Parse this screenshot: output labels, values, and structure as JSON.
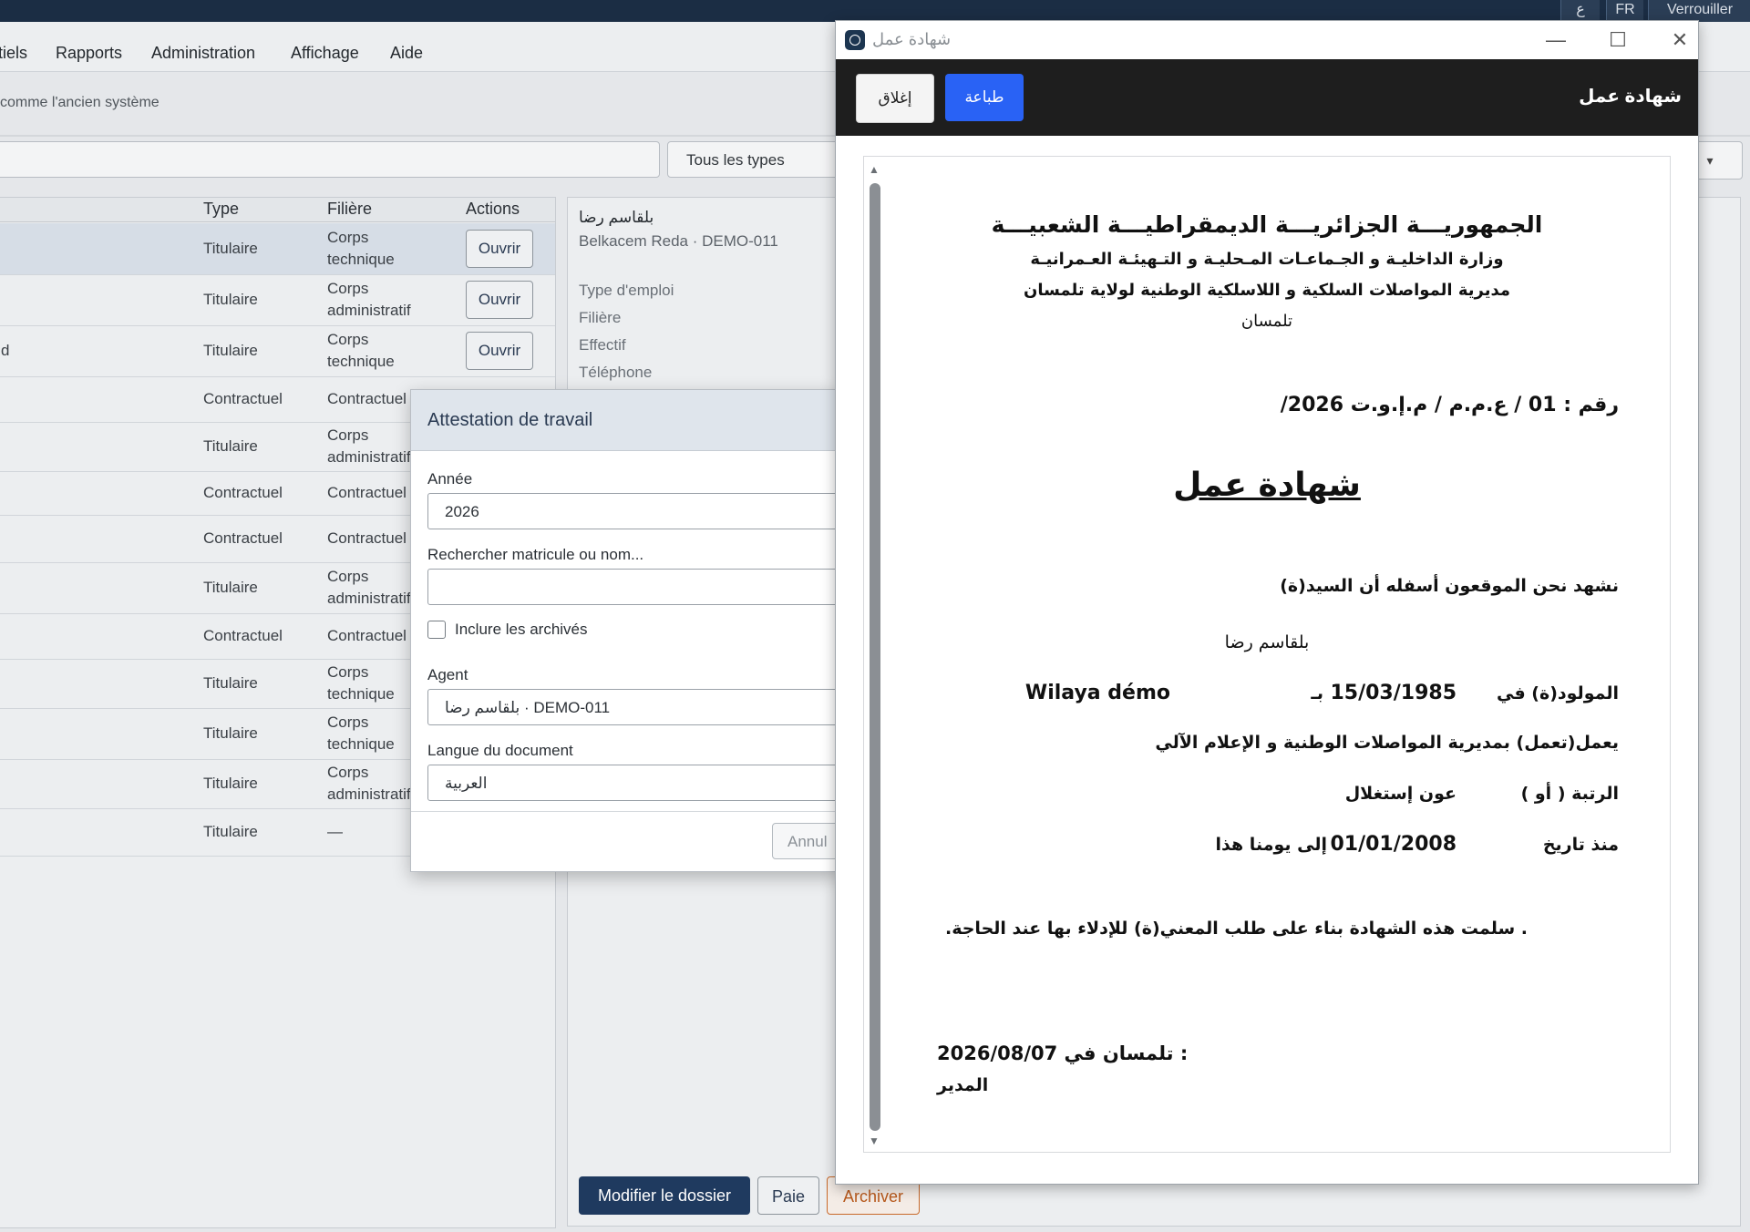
{
  "topbar": {
    "lang_ar": "ع",
    "lang_fr": "FR",
    "lock": "Verrouiller"
  },
  "menu": {
    "items": [
      "tiels",
      "Rapports",
      "Administration",
      "Affichage",
      "Aide"
    ]
  },
  "info_text": "comme l'ancien système",
  "filters": {
    "type_select": "Tous les types",
    "right_select": "▾"
  },
  "table": {
    "headers": {
      "type": "Type",
      "filiere": "Filière",
      "actions": "Actions"
    },
    "open_label": "Ouvrir",
    "rows": [
      {
        "name": "",
        "type": "Titulaire",
        "filiere": [
          "Corps",
          "technique"
        ],
        "open": true,
        "selected": true
      },
      {
        "name": "",
        "type": "Titulaire",
        "filiere": [
          "Corps",
          "administratif"
        ],
        "open": true
      },
      {
        "name": "d",
        "type": "Titulaire",
        "filiere": [
          "Corps",
          "technique"
        ],
        "open": true
      },
      {
        "name": "",
        "type": "Contractuel",
        "filiere": [
          "Contractuel"
        ],
        "open": false
      },
      {
        "name": "",
        "type": "Titulaire",
        "filiere": [
          "Corps",
          "administratif"
        ],
        "open": false
      },
      {
        "name": "",
        "type": "Contractuel",
        "filiere": [
          "Contractuel"
        ],
        "open": false
      },
      {
        "name": "",
        "type": "Contractuel",
        "filiere": [
          "Contractuel"
        ],
        "open": false
      },
      {
        "name": "",
        "type": "Titulaire",
        "filiere": [
          "Corps",
          "administratif"
        ],
        "open": false
      },
      {
        "name": "",
        "type": "Contractuel",
        "filiere": [
          "Contractuel"
        ],
        "open": false
      },
      {
        "name": "",
        "type": "Titulaire",
        "filiere": [
          "Corps",
          "technique"
        ],
        "open": false
      },
      {
        "name": "",
        "type": "Titulaire",
        "filiere": [
          "Corps",
          "technique"
        ],
        "open": false
      },
      {
        "name": "",
        "type": "Titulaire",
        "filiere": [
          "Corps",
          "administratif"
        ],
        "open": false
      },
      {
        "name": "",
        "type": "Titulaire",
        "filiere": [
          "—"
        ],
        "open": false
      }
    ]
  },
  "detail": {
    "name_ar": "بلقاسم رضا",
    "subtitle": "Belkacem Reda · DEMO-011",
    "labels": [
      "Type d'emploi",
      "Filière",
      "Effectif",
      "Téléphone"
    ],
    "buttons": {
      "edit": "Modifier le dossier",
      "pay": "Paie",
      "archive": "Archiver"
    }
  },
  "modal": {
    "title": "Attestation de travail",
    "year_label": "Année",
    "year_value": "2026",
    "search_label": "Rechercher matricule ou nom...",
    "search_value": "",
    "include_archived": "Inclure les archivés",
    "agent_label": "Agent",
    "agent_value": "بلقاسم رضا · DEMO-011",
    "lang_label": "Langue du document",
    "lang_value": "العربية",
    "cancel": "Annul"
  },
  "preview": {
    "window_title": "شهادة عمل",
    "toolbar_title": "شهادة عمل",
    "close": "إغلاق",
    "print": "طباعة",
    "doc": {
      "republic": "الجمهوريـــة الجزائريـــة الديمقراطيـــة الشعبيـــة",
      "ministry": "وزارة الداخليـة و الجـماعـات المـحليـة و التـهيئـة العـمرانيـة",
      "directorate": "مديرية المواصلات السلكية و اللاسلكية الوطنية لولاية تلمسان",
      "city": "تلمسان",
      "ref_prefix": "رقم :",
      "ref_number": "01",
      "ref_suffix": "/ ع.م.م / م.إ.و.ت 2026/",
      "heading": "شهادة عمل",
      "attest_line": "نشهد نحن الموقعون أسفله أن السيد(ة)",
      "agent_name": "بلقاسم رضا",
      "born_label": "المولود(ة) في",
      "birth_date": "15/03/1985",
      "at_label": "بـ",
      "birth_place": "Wilaya démo",
      "works_line": "يعمل(تعمل) بمديرية المواصلات الوطنية و الإعلام الآلي",
      "rank_label": "الرتبة ( أو )",
      "rank_value": "عون إستغلال",
      "since_label": "منذ تاريخ",
      "since_date": "01/01/2008",
      "until_today": "إلى يومنا هذا",
      "issued_line": ". سلمت هذه الشهادة بناء على طلب المعني(ة) للإدلاء بها عند الحاجة.",
      "place_date_label": "تلمسان في :",
      "place_date_value": "2026/08/07",
      "signatory": "المدير"
    }
  },
  "colors": {
    "topbar": "#1b2d44",
    "primary_button": "#1f3a5f",
    "print_button": "#2962f5",
    "archive_border": "#c96a2b"
  }
}
